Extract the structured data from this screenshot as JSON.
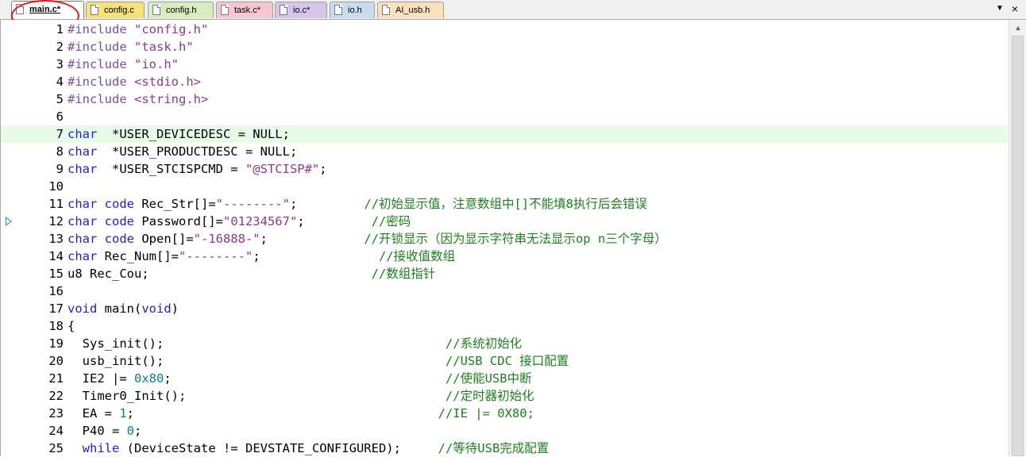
{
  "tabs": [
    {
      "label": "main.c*",
      "color": "#ffffff",
      "active": true
    },
    {
      "label": "config.c",
      "color": "#f6e27a",
      "active": false
    },
    {
      "label": "config.h",
      "color": "#d9ecc0",
      "active": false
    },
    {
      "label": "task.c*",
      "color": "#f6c7d2",
      "active": false
    },
    {
      "label": "io.c*",
      "color": "#d6c4ea",
      "active": false
    },
    {
      "label": "io.h",
      "color": "#c9dcef",
      "active": false
    },
    {
      "label": "AI_usb.h",
      "color": "#fbe0bd",
      "active": false
    }
  ],
  "tab_controls": {
    "dropdown_icon": "chevron-down-icon",
    "close_icon": "close-icon",
    "dropdown_glyph": "▼",
    "close_glyph": "×"
  },
  "editor": {
    "highlight_line": 7,
    "exec_marker_line": 12,
    "lines": [
      {
        "n": "1",
        "t": [
          [
            "pp",
            "#include "
          ],
          [
            "str",
            "\"config.h\""
          ]
        ]
      },
      {
        "n": "2",
        "t": [
          [
            "pp",
            "#include "
          ],
          [
            "str",
            "\"task.h\""
          ]
        ]
      },
      {
        "n": "3",
        "t": [
          [
            "pp",
            "#include "
          ],
          [
            "str",
            "\"io.h\""
          ]
        ]
      },
      {
        "n": "4",
        "t": [
          [
            "pp",
            "#include "
          ],
          [
            "str",
            "<stdio.h>"
          ]
        ]
      },
      {
        "n": "5",
        "t": [
          [
            "pp",
            "#include "
          ],
          [
            "str",
            "<string.h>"
          ]
        ]
      },
      {
        "n": "6",
        "t": []
      },
      {
        "n": "7",
        "t": [
          [
            "kw",
            "char"
          ],
          [
            "",
            "  *USER_DEVICEDESC = NULL;"
          ]
        ]
      },
      {
        "n": "8",
        "t": [
          [
            "kw",
            "char"
          ],
          [
            "",
            "  *USER_PRODUCTDESC = NULL;"
          ]
        ]
      },
      {
        "n": "9",
        "t": [
          [
            "kw",
            "char"
          ],
          [
            "",
            "  *USER_STCISPCMD = "
          ],
          [
            "str",
            "\"@STCISP#\""
          ],
          [
            "",
            ";"
          ]
        ]
      },
      {
        "n": "10",
        "t": []
      },
      {
        "n": "11",
        "t": [
          [
            "kw",
            "char"
          ],
          [
            "",
            " "
          ],
          [
            "kw",
            "code"
          ],
          [
            "",
            " Rec_Str[]="
          ],
          [
            "str",
            "\"--------\""
          ],
          [
            "",
            ";         "
          ],
          [
            "cm",
            "//初始显示值，注意数组中[]不能填8执行后会错误"
          ]
        ]
      },
      {
        "n": "12",
        "t": [
          [
            "kw",
            "char"
          ],
          [
            "",
            " "
          ],
          [
            "kw",
            "code"
          ],
          [
            "",
            " Password[]="
          ],
          [
            "str",
            "\"01234567\""
          ],
          [
            "",
            ";         "
          ],
          [
            "cm",
            "//密码"
          ]
        ]
      },
      {
        "n": "13",
        "t": [
          [
            "kw",
            "char"
          ],
          [
            "",
            " "
          ],
          [
            "kw",
            "code"
          ],
          [
            "",
            " Open[]="
          ],
          [
            "str",
            "\"-16888-\""
          ],
          [
            "",
            ";             "
          ],
          [
            "cm",
            "//开锁显示（因为显示字符串无法显示op n三个字母）"
          ]
        ]
      },
      {
        "n": "14",
        "t": [
          [
            "kw",
            "char"
          ],
          [
            "",
            " Rec_Num[]="
          ],
          [
            "str",
            "\"--------\""
          ],
          [
            "",
            ";                "
          ],
          [
            "cm",
            "//接收值数组"
          ]
        ]
      },
      {
        "n": "15",
        "t": [
          [
            "",
            "u8 Rec_Cou;                              "
          ],
          [
            "cm",
            "//数组指针"
          ]
        ]
      },
      {
        "n": "16",
        "t": []
      },
      {
        "n": "17",
        "t": [
          [
            "kw",
            "void"
          ],
          [
            "",
            " main("
          ],
          [
            "kw",
            "void"
          ],
          [
            "",
            ")"
          ]
        ]
      },
      {
        "n": "18",
        "t": [
          [
            "",
            "{"
          ]
        ]
      },
      {
        "n": "19",
        "t": [
          [
            "",
            "  Sys_init();                                      "
          ],
          [
            "cm",
            "//系统初始化"
          ]
        ]
      },
      {
        "n": "20",
        "t": [
          [
            "",
            "  usb_init();                                      "
          ],
          [
            "cm",
            "//USB CDC 接口配置"
          ]
        ]
      },
      {
        "n": "21",
        "t": [
          [
            "",
            "  IE2 |= "
          ],
          [
            "num",
            "0x80"
          ],
          [
            "",
            ";                                     "
          ],
          [
            "cm",
            "//使能USB中断"
          ]
        ]
      },
      {
        "n": "22",
        "t": [
          [
            "",
            "  Timer0_Init();                                   "
          ],
          [
            "cm",
            "//定时器初始化"
          ]
        ]
      },
      {
        "n": "23",
        "t": [
          [
            "",
            "  EA = "
          ],
          [
            "num",
            "1"
          ],
          [
            "",
            ";                                         "
          ],
          [
            "cm",
            "//IE |= 0X80;"
          ]
        ]
      },
      {
        "n": "24",
        "t": [
          [
            "",
            "  P40 = "
          ],
          [
            "num",
            "0"
          ],
          [
            "",
            ";"
          ]
        ]
      },
      {
        "n": "25",
        "t": [
          [
            "",
            "  "
          ],
          [
            "kw",
            "while"
          ],
          [
            "",
            " (DeviceState != DEVSTATE_CONFIGURED);     "
          ],
          [
            "cm",
            "//等待USB完成配置"
          ]
        ]
      }
    ]
  },
  "scrollbar": {
    "up_icon": "scroll-up-arrow-icon",
    "up_glyph": "▲"
  }
}
